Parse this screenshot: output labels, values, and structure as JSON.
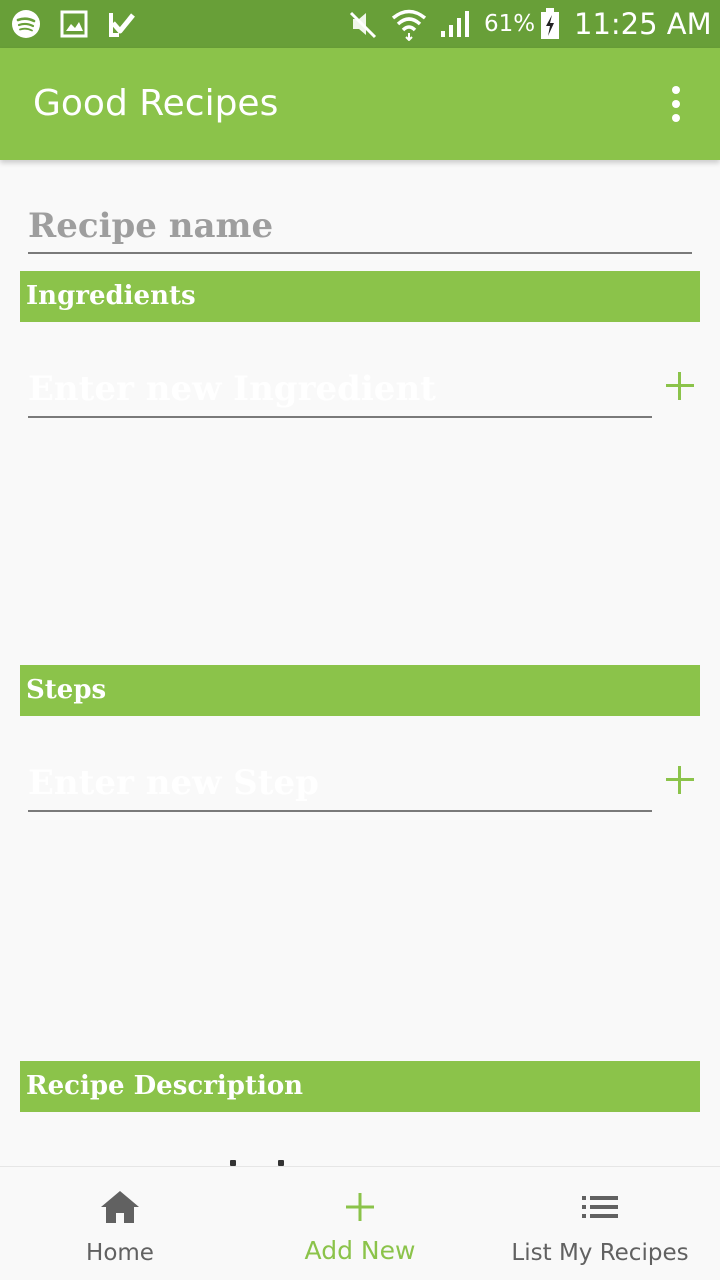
{
  "status_bar": {
    "battery": "61%",
    "time": "11:25 AM"
  },
  "app_bar": {
    "title": "Good Recipes"
  },
  "form": {
    "recipe_name_placeholder": "Recipe name",
    "ingredients_header": "Ingredients",
    "ingredient_placeholder": "Enter new Ingredient",
    "steps_header": "Steps",
    "step_placeholder": "Enter new Step",
    "description_header": "Recipe Description"
  },
  "bottom_nav": {
    "items": [
      {
        "label": "Home",
        "icon": "home-icon"
      },
      {
        "label": "Add New",
        "icon": "plus-icon",
        "active": true
      },
      {
        "label": "List My Recipes",
        "icon": "list-icon"
      }
    ]
  },
  "colors": {
    "accent": "#8bc34a",
    "status_bar": "#689f38",
    "background": "#f9f9f9"
  }
}
